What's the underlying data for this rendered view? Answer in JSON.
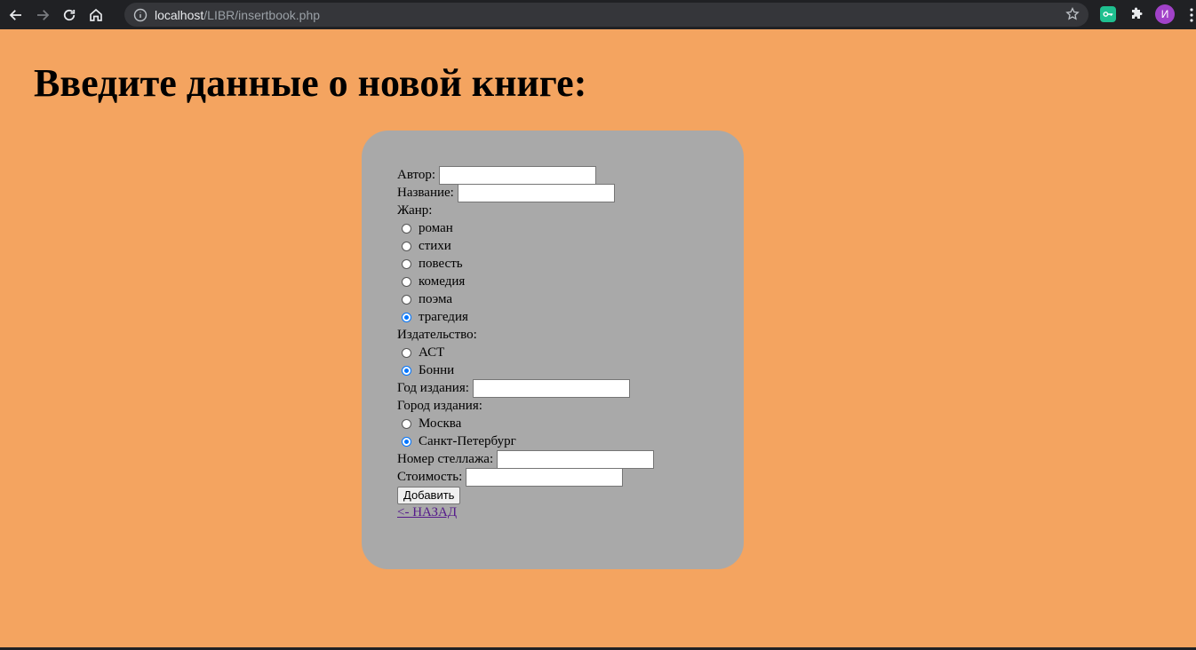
{
  "browser": {
    "url_host": "localhost",
    "url_path": "/LIBR/insertbook.php",
    "avatar_letter": "И"
  },
  "page": {
    "heading": "Введите данные о новой книге:"
  },
  "form": {
    "author_label": "Автор:",
    "author_value": "",
    "title_label": "Название:",
    "title_value": "",
    "genre_label": "Жанр:",
    "genres": [
      {
        "label": "роман",
        "checked": false
      },
      {
        "label": "стихи",
        "checked": false
      },
      {
        "label": "повесть",
        "checked": false
      },
      {
        "label": "комедия",
        "checked": false
      },
      {
        "label": "поэма",
        "checked": false
      },
      {
        "label": "трагедия",
        "checked": true
      }
    ],
    "publisher_label": "Издательство:",
    "publishers": [
      {
        "label": "АСТ",
        "checked": false
      },
      {
        "label": "Бонни",
        "checked": true
      }
    ],
    "year_label": "Год издания:",
    "year_value": "",
    "city_label": "Город издания:",
    "cities": [
      {
        "label": "Москва",
        "checked": false
      },
      {
        "label": "Санкт-Петербург",
        "checked": true
      }
    ],
    "shelf_label": "Номер стеллажа:",
    "shelf_value": "",
    "price_label": "Стоимость:",
    "price_value": "",
    "submit_label": "Добавить",
    "back_link": "<- НАЗАД"
  },
  "colors": {
    "page_background": "#f4a460",
    "form_background": "#a9a9a9",
    "radio_checked": "#0075ff"
  }
}
